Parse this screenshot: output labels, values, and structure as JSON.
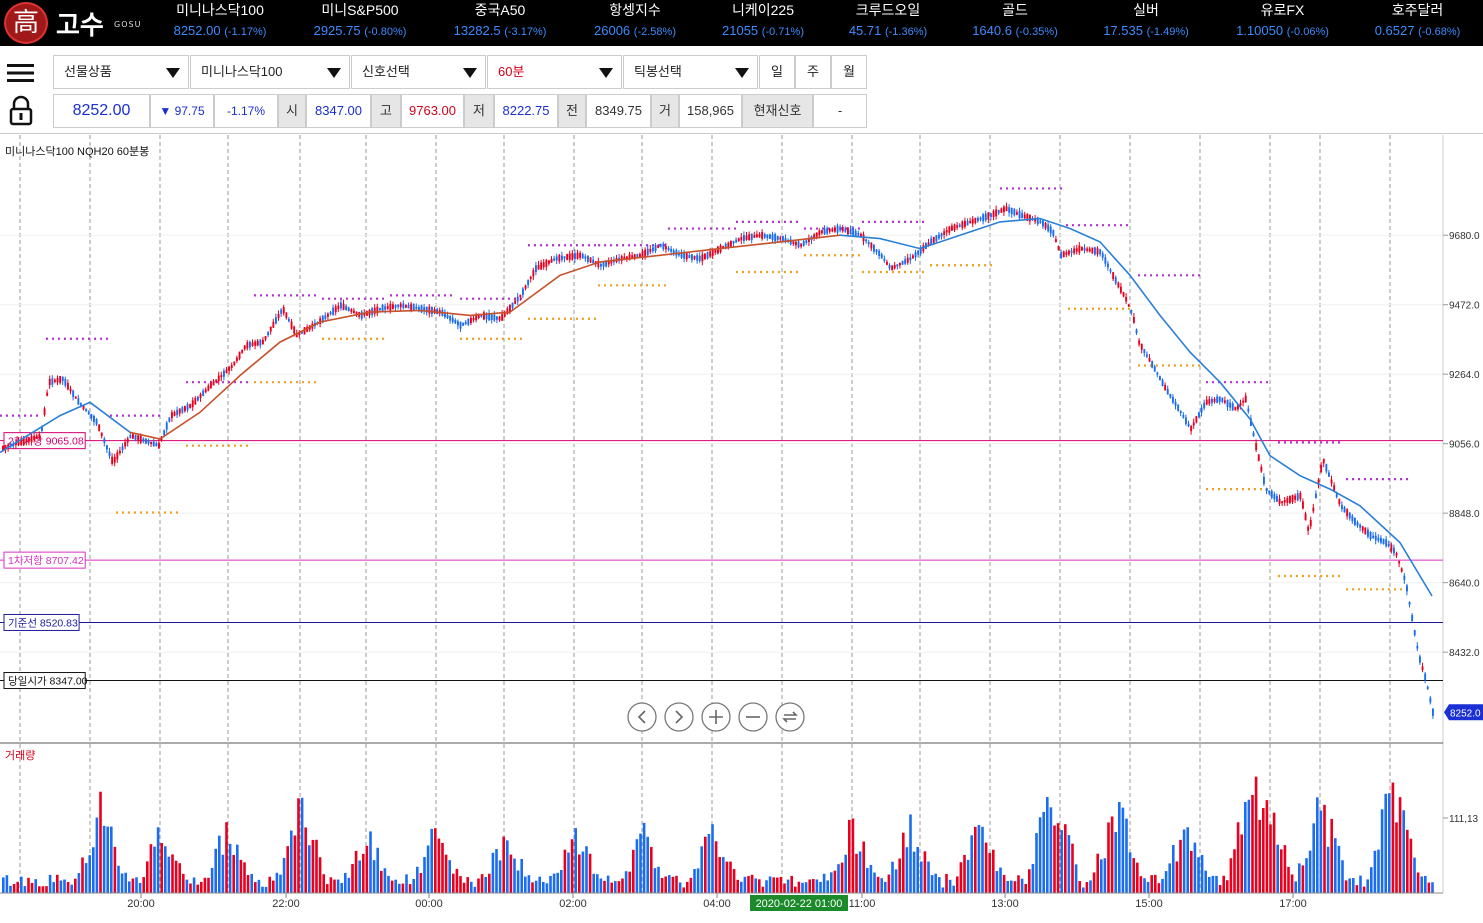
{
  "ticker": {
    "logo": {
      "char": "高",
      "brand": "고수",
      "sub": "GOSU"
    },
    "items": [
      {
        "name": "미니나스닥100",
        "value": "8252.00",
        "change": "(-1.17%)"
      },
      {
        "name": "미니S&P500",
        "value": "2925.75",
        "change": "(-0.80%)"
      },
      {
        "name": "중국A50",
        "value": "13282.5",
        "change": "(-3.17%)"
      },
      {
        "name": "항셍지수",
        "value": "26006",
        "change": "(-2.58%)"
      },
      {
        "name": "니케이225",
        "value": "21055",
        "change": "(-0.71%)"
      },
      {
        "name": "크루드오일",
        "value": "45.71",
        "change": "(-1.36%)"
      },
      {
        "name": "골드",
        "value": "1640.6",
        "change": "(-0.35%)"
      },
      {
        "name": "실버",
        "value": "17.535",
        "change": "(-1.49%)"
      },
      {
        "name": "유로FX",
        "value": "1.10050",
        "change": "(-0.06%)"
      },
      {
        "name": "호주달러",
        "value": "0.6527",
        "change": "(-0.68%)"
      }
    ]
  },
  "toolbar": {
    "product": "선물상품",
    "symbol": "미니나스닥100",
    "signal": "신호선택",
    "interval": "60분",
    "tick": "틱봉선택",
    "periods": [
      "일",
      "주",
      "월"
    ],
    "quote": {
      "price": "8252.00",
      "change": "▼ 97.75",
      "pct": "-1.17%",
      "open_label": "시",
      "open": "8347.00",
      "high_label": "고",
      "high": "9763.00",
      "low_label": "저",
      "low": "8222.75",
      "prev_label": "전",
      "prev": "8349.75",
      "vol_label": "거",
      "volume": "158,965",
      "signal_label": "현재신호",
      "signal_value": "-"
    }
  },
  "chart_data": {
    "type": "candlestick",
    "title": "미니나스닥100  NQH20  60분봉",
    "y_ticks": [
      "9680.0",
      "9472.0",
      "9264.0",
      "9056.0",
      "8848.0",
      "8640.0",
      "8432.0"
    ],
    "y_range": [
      8160,
      9980
    ],
    "x_ticks": [
      "20:00",
      "22:00",
      "00:00",
      "02:00",
      "04:00",
      "11:00",
      "13:00",
      "15:00",
      "17:00"
    ],
    "x_highlight": "2020-02-22 01:00",
    "last_price_tag": "8252.0",
    "levels": [
      {
        "label": "2차저항 9065.08",
        "value": 9065.08,
        "color": "#d6006e"
      },
      {
        "label": "1차저항 8707.42",
        "value": 8707.42,
        "color": "#d631c4"
      },
      {
        "label": "기준선 8520.83",
        "value": 8520.83,
        "color": "#1b1b9e"
      },
      {
        "label": "당일시가 8347.00",
        "value": 8347.0,
        "color": "#111111"
      }
    ],
    "path_points": [
      [
        0,
        9040
      ],
      [
        40,
        9080
      ],
      [
        48,
        9240
      ],
      [
        62,
        9250
      ],
      [
        78,
        9180
      ],
      [
        96,
        9120
      ],
      [
        112,
        9000
      ],
      [
        130,
        9080
      ],
      [
        158,
        9050
      ],
      [
        170,
        9140
      ],
      [
        190,
        9170
      ],
      [
        210,
        9230
      ],
      [
        232,
        9290
      ],
      [
        245,
        9350
      ],
      [
        262,
        9360
      ],
      [
        282,
        9460
      ],
      [
        296,
        9380
      ],
      [
        318,
        9420
      ],
      [
        340,
        9470
      ],
      [
        360,
        9440
      ],
      [
        380,
        9460
      ],
      [
        400,
        9470
      ],
      [
        420,
        9460
      ],
      [
        440,
        9450
      ],
      [
        460,
        9410
      ],
      [
        480,
        9440
      ],
      [
        500,
        9430
      ],
      [
        520,
        9500
      ],
      [
        535,
        9580
      ],
      [
        555,
        9610
      ],
      [
        580,
        9620
      ],
      [
        600,
        9590
      ],
      [
        620,
        9610
      ],
      [
        640,
        9620
      ],
      [
        660,
        9650
      ],
      [
        680,
        9620
      ],
      [
        700,
        9610
      ],
      [
        720,
        9640
      ],
      [
        740,
        9670
      ],
      [
        760,
        9680
      ],
      [
        780,
        9670
      ],
      [
        800,
        9650
      ],
      [
        820,
        9690
      ],
      [
        840,
        9700
      ],
      [
        860,
        9680
      ],
      [
        880,
        9620
      ],
      [
        890,
        9580
      ],
      [
        910,
        9610
      ],
      [
        930,
        9660
      ],
      [
        950,
        9700
      ],
      [
        970,
        9720
      ],
      [
        990,
        9740
      ],
      [
        1005,
        9760
      ],
      [
        1020,
        9740
      ],
      [
        1040,
        9720
      ],
      [
        1052,
        9690
      ],
      [
        1060,
        9620
      ],
      [
        1080,
        9640
      ],
      [
        1100,
        9630
      ],
      [
        1112,
        9560
      ],
      [
        1125,
        9490
      ],
      [
        1132,
        9440
      ],
      [
        1138,
        9360
      ],
      [
        1150,
        9300
      ],
      [
        1165,
        9220
      ],
      [
        1180,
        9150
      ],
      [
        1190,
        9100
      ],
      [
        1205,
        9180
      ],
      [
        1220,
        9190
      ],
      [
        1235,
        9160
      ],
      [
        1245,
        9190
      ],
      [
        1255,
        9050
      ],
      [
        1265,
        8920
      ],
      [
        1280,
        8880
      ],
      [
        1300,
        8900
      ],
      [
        1308,
        8790
      ],
      [
        1322,
        9010
      ],
      [
        1340,
        8870
      ],
      [
        1355,
        8820
      ],
      [
        1370,
        8780
      ],
      [
        1385,
        8760
      ],
      [
        1395,
        8730
      ],
      [
        1405,
        8640
      ],
      [
        1412,
        8520
      ],
      [
        1418,
        8420
      ],
      [
        1425,
        8350
      ],
      [
        1432,
        8252
      ]
    ],
    "ma_points": [
      [
        0,
        9030
      ],
      [
        60,
        9140
      ],
      [
        90,
        9180
      ],
      [
        130,
        9090
      ],
      [
        160,
        9070
      ],
      [
        200,
        9150
      ],
      [
        240,
        9260
      ],
      [
        280,
        9360
      ],
      [
        320,
        9420
      ],
      [
        370,
        9450
      ],
      [
        420,
        9455
      ],
      [
        470,
        9440
      ],
      [
        510,
        9450
      ],
      [
        560,
        9560
      ],
      [
        600,
        9600
      ],
      [
        660,
        9620
      ],
      [
        720,
        9640
      ],
      [
        780,
        9660
      ],
      [
        840,
        9680
      ],
      [
        880,
        9670
      ],
      [
        920,
        9640
      ],
      [
        960,
        9680
      ],
      [
        1000,
        9720
      ],
      [
        1040,
        9730
      ],
      [
        1070,
        9700
      ],
      [
        1100,
        9660
      ],
      [
        1130,
        9560
      ],
      [
        1160,
        9440
      ],
      [
        1190,
        9330
      ],
      [
        1220,
        9240
      ],
      [
        1250,
        9130
      ],
      [
        1270,
        9020
      ],
      [
        1300,
        8960
      ],
      [
        1330,
        8920
      ],
      [
        1360,
        8870
      ],
      [
        1400,
        8760
      ],
      [
        1432,
        8600
      ]
    ],
    "ma_split_x": 860,
    "dotted_levels": [
      {
        "x1": 0,
        "x2": 40,
        "value": 9140,
        "color": "#b431d6"
      },
      {
        "x1": 46,
        "x2": 110,
        "value": 9370,
        "color": "#b431d6"
      },
      {
        "x1": 110,
        "x2": 160,
        "value": 9140,
        "color": "#b431d6"
      },
      {
        "x1": 116,
        "x2": 180,
        "value": 8850,
        "color": "#f0a020"
      },
      {
        "x1": 186,
        "x2": 250,
        "value": 9050,
        "color": "#f0a020"
      },
      {
        "x1": 186,
        "x2": 250,
        "value": 9240,
        "color": "#b431d6"
      },
      {
        "x1": 254,
        "x2": 320,
        "value": 9500,
        "color": "#b431d6"
      },
      {
        "x1": 254,
        "x2": 320,
        "value": 9240,
        "color": "#f0a020"
      },
      {
        "x1": 322,
        "x2": 386,
        "value": 9490,
        "color": "#b431d6"
      },
      {
        "x1": 322,
        "x2": 386,
        "value": 9370,
        "color": "#f0a020"
      },
      {
        "x1": 390,
        "x2": 456,
        "value": 9500,
        "color": "#b431d6"
      },
      {
        "x1": 460,
        "x2": 524,
        "value": 9370,
        "color": "#f0a020"
      },
      {
        "x1": 460,
        "x2": 524,
        "value": 9490,
        "color": "#b431d6"
      },
      {
        "x1": 528,
        "x2": 596,
        "value": 9650,
        "color": "#b431d6"
      },
      {
        "x1": 528,
        "x2": 596,
        "value": 9430,
        "color": "#f0a020"
      },
      {
        "x1": 598,
        "x2": 666,
        "value": 9650,
        "color": "#b431d6"
      },
      {
        "x1": 598,
        "x2": 666,
        "value": 9530,
        "color": "#f0a020"
      },
      {
        "x1": 668,
        "x2": 736,
        "value": 9700,
        "color": "#b431d6"
      },
      {
        "x1": 736,
        "x2": 800,
        "value": 9570,
        "color": "#f0a020"
      },
      {
        "x1": 736,
        "x2": 800,
        "value": 9720,
        "color": "#b431d6"
      },
      {
        "x1": 804,
        "x2": 860,
        "value": 9620,
        "color": "#f0a020"
      },
      {
        "x1": 804,
        "x2": 860,
        "value": 9700,
        "color": "#b431d6"
      },
      {
        "x1": 862,
        "x2": 928,
        "value": 9720,
        "color": "#b431d6"
      },
      {
        "x1": 862,
        "x2": 928,
        "value": 9570,
        "color": "#f0a020"
      },
      {
        "x1": 930,
        "x2": 996,
        "value": 9590,
        "color": "#f0a020"
      },
      {
        "x1": 1000,
        "x2": 1064,
        "value": 9820,
        "color": "#b431d6"
      },
      {
        "x1": 1066,
        "x2": 1132,
        "value": 9710,
        "color": "#b431d6"
      },
      {
        "x1": 1068,
        "x2": 1132,
        "value": 9460,
        "color": "#f0a020"
      },
      {
        "x1": 1138,
        "x2": 1202,
        "value": 9560,
        "color": "#b431d6"
      },
      {
        "x1": 1138,
        "x2": 1202,
        "value": 9290,
        "color": "#f0a020"
      },
      {
        "x1": 1206,
        "x2": 1270,
        "value": 9240,
        "color": "#b431d6"
      },
      {
        "x1": 1206,
        "x2": 1270,
        "value": 8920,
        "color": "#f0a020"
      },
      {
        "x1": 1278,
        "x2": 1340,
        "value": 9060,
        "color": "#b431d6"
      },
      {
        "x1": 1278,
        "x2": 1340,
        "value": 8660,
        "color": "#f0a020"
      },
      {
        "x1": 1346,
        "x2": 1410,
        "value": 8950,
        "color": "#b431d6"
      },
      {
        "x1": 1346,
        "x2": 1410,
        "value": 8620,
        "color": "#f0a020"
      }
    ],
    "volume_label": "거래량",
    "volume_tick": "111,13",
    "nav_buttons": [
      "prev",
      "next",
      "zoom-in",
      "zoom-out",
      "reset"
    ]
  }
}
